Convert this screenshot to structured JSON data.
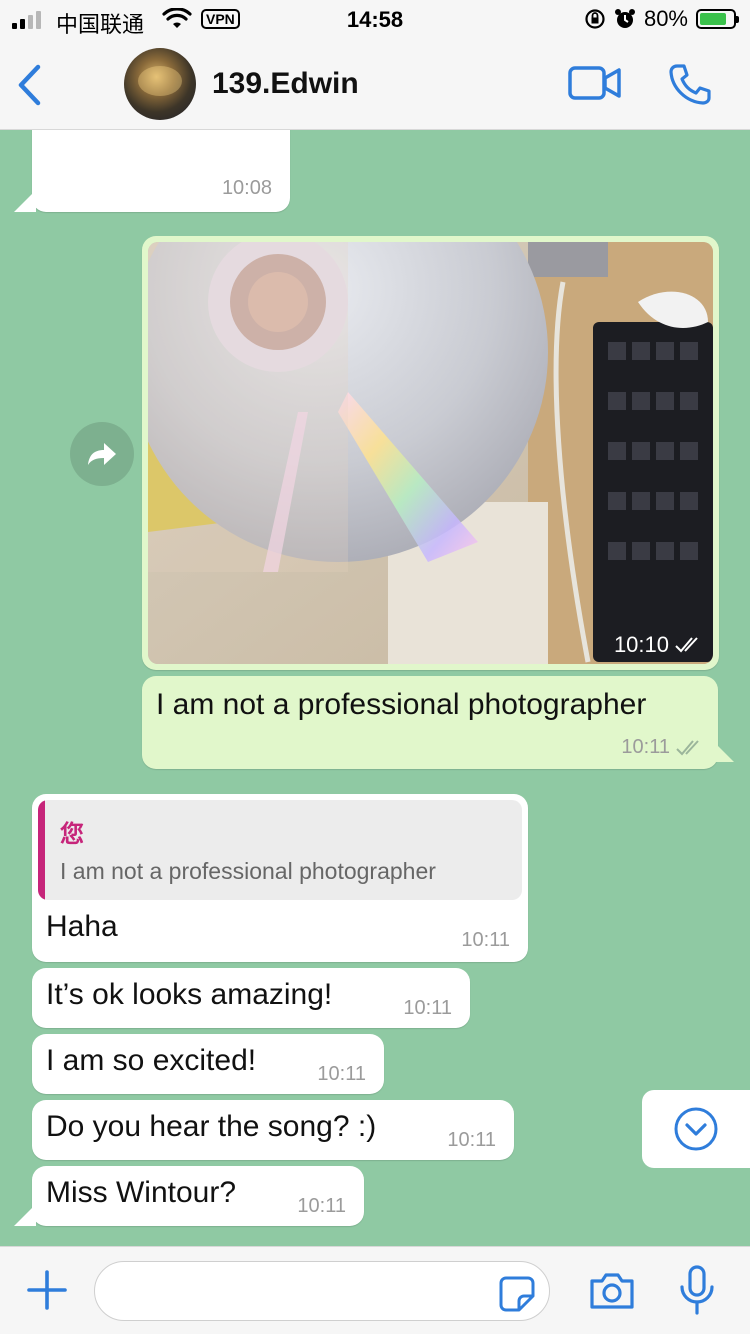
{
  "status_bar": {
    "carrier": "中国联通",
    "vpn": "VPN",
    "time": "14:58",
    "battery": "80%",
    "battery_level": 0.8
  },
  "header": {
    "contact_name": "139.Edwin",
    "icons": [
      "back-chevron-icon",
      "video-call-icon",
      "phone-call-icon"
    ]
  },
  "messages": {
    "m0": {
      "time": "10:08"
    },
    "photo": {
      "time": "10:10"
    },
    "m1": {
      "text": "I am not a professional photographer",
      "time": "10:11"
    },
    "m2": {
      "reply_author": "您",
      "reply_text": "I am not a professional photographer",
      "text": "Haha",
      "time": "10:11"
    },
    "m3": {
      "text": "It’s ok looks amazing!",
      "time": "10:11"
    },
    "m4": {
      "text": "I am so excited!",
      "time": "10:11"
    },
    "m5": {
      "text": "Do you hear the song? :)",
      "time": "10:11"
    },
    "m6": {
      "text": "Miss Wintour?",
      "time": "10:11"
    }
  },
  "input": {
    "placeholder": ""
  },
  "colors": {
    "accent": "#2f7ddb",
    "chat_bg": "#8fc9a3",
    "outgoing": "#e1f7cb",
    "incoming": "#ffffff",
    "reply_author": "#c6257a"
  }
}
